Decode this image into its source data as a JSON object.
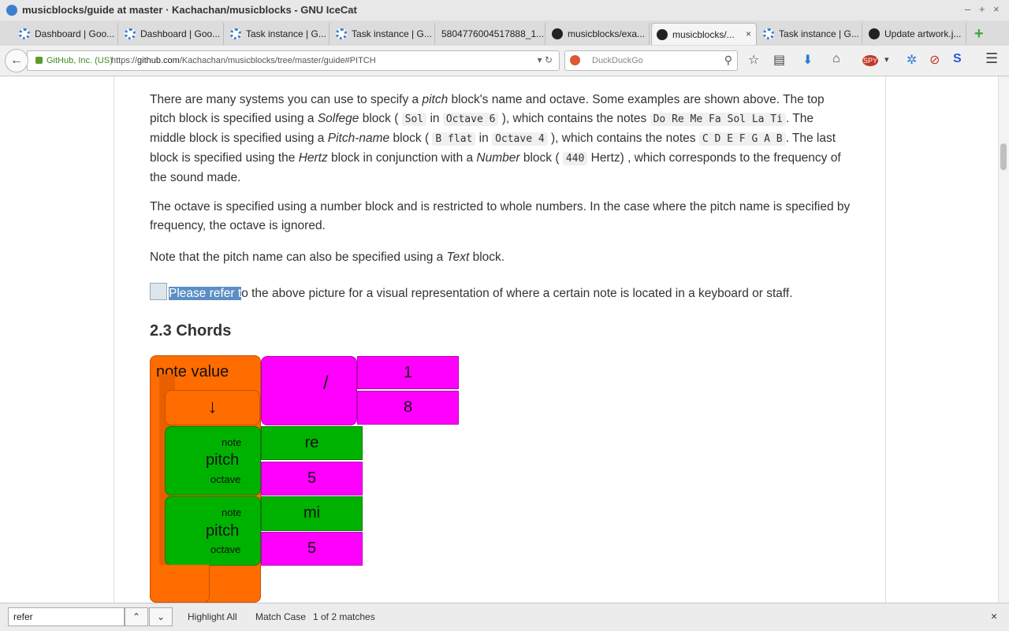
{
  "window": {
    "title": "musicblocks/guide at master · Kachachan/musicblocks - GNU IceCat",
    "minimize": "–",
    "maximize": "+",
    "close": "×"
  },
  "tabs": [
    {
      "label": "Dashboard | Goo..."
    },
    {
      "label": "Dashboard | Goo..."
    },
    {
      "label": "Task instance | G..."
    },
    {
      "label": "Task instance | G..."
    },
    {
      "label": "5804776004517888_1..."
    },
    {
      "label": "musicblocks/exa..."
    },
    {
      "label": "musicblocks/...",
      "close": "×"
    },
    {
      "label": "Task instance | G..."
    },
    {
      "label": "Update artwork.j..."
    }
  ],
  "newtab": "+",
  "nav": {
    "back": "←",
    "identity": "GitHub, Inc. (US)",
    "url_prefix": "https://",
    "url_domain": "github.com",
    "url_path": "/Kachachan/musicblocks/tree/master/guide#PITCH",
    "url_buttons": "▾  ↻",
    "search_placeholder": "DuckDuckGo",
    "search_icon": "⚲"
  },
  "toolbar_icons": [
    "☆",
    "▤",
    "⬇",
    "⌂",
    "SPY",
    "▾",
    "✲",
    "⊘",
    "S",
    "☰"
  ],
  "article": {
    "p1": {
      "t1": "There are many systems you can use to specify a ",
      "e1": "pitch",
      "t2": " block's name and octave. Some examples are shown above. The top pitch block is specified using a ",
      "e2": "Solfege",
      "t3": " block ( ",
      "c1": "Sol",
      "t4": " in ",
      "c2": "Octave 6",
      "t5": " ), which contains the notes ",
      "c3": "Do Re Me Fa Sol La Ti",
      "t6": ". The middle block is specified using a ",
      "e3": "Pitch-name",
      "t7": " block ( ",
      "c4": "B flat",
      "t8": " in ",
      "c5": "Octave 4",
      "t9": " ), which contains the notes ",
      "c6": "C D E F G A B",
      "t10": ". The last block is specified using the ",
      "e4": "Hertz",
      "t11": " block in conjunction with a ",
      "e5": "Number",
      "t12": " block ( ",
      "c7": "440",
      "t13": " Hertz) , which corresponds to the frequency of the sound made."
    },
    "p2": "The octave is specified using a number block and is restricted to whole numbers. In the case where the pitch name is specified by frequency, the octave is ignored.",
    "p3": {
      "t1": "Note that the pitch name can also be specified using a ",
      "e1": "Text",
      "t2": " block."
    },
    "p4": {
      "highlight": "Please refer t",
      "rest": "o the above picture for a visual representation of where a certain note is located in a keyboard or staff."
    },
    "heading": "2.3 Chords",
    "blocks": {
      "note_value": "note value",
      "divide": "/",
      "num1": "1",
      "num2": "8",
      "arrow": "↓",
      "pitch1": {
        "note_label": "note",
        "name": "pitch",
        "octave_label": "octave",
        "note": "re",
        "octave": "5"
      },
      "pitch2": {
        "note_label": "note",
        "name": "pitch",
        "octave_label": "octave",
        "note": "mi",
        "octave": "5"
      }
    }
  },
  "findbar": {
    "query": "refer",
    "prev": "⌃",
    "next": "⌄",
    "highlight_all": "Highlight All",
    "match_case": "Match Case",
    "status": "1 of 2 matches",
    "close": "×"
  },
  "colors": {
    "block_orange": "#ff6c00",
    "block_magenta": "#ff00ff",
    "block_green": "#00b200",
    "find_highlight": "#5b8ec4"
  }
}
